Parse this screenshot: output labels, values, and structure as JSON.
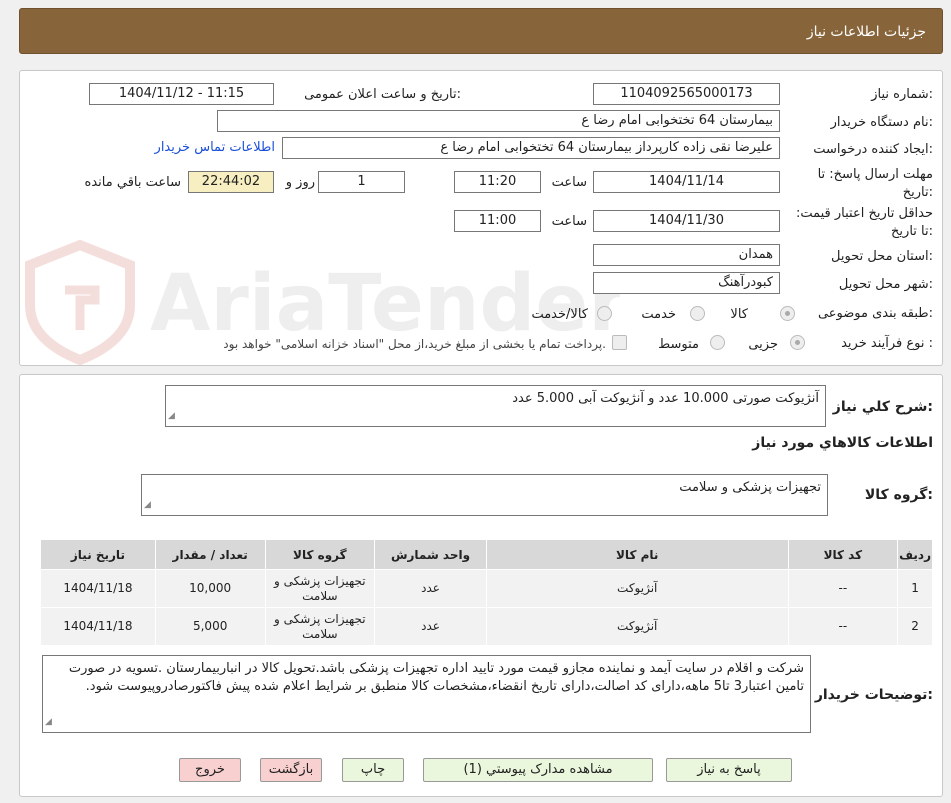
{
  "header": {
    "title": "جزئیات اطلاعات نیاز"
  },
  "form": {
    "need_number_label": "شماره نیاز:",
    "need_number": "1104092565000173",
    "announce_label": "تاریخ و ساعت اعلان عمومی:",
    "announce_value": "1404/11/12 - 11:15",
    "buyer_org_label": "نام دستگاه خریدار:",
    "buyer_org": "بیمارستان  64 تختخوابی امام رضا   ع",
    "creator_label": "ایجاد کننده درخواست:",
    "creator": "علیرضا نقی زاده کارپرداز بیمارستان  64 تختخوابی امام رضا   ع",
    "contact_link": "اطلاعات تماس خریدار",
    "deadline_label": "مهلت ارسال پاسخ: تا تاریخ:",
    "deadline_date": "1404/11/14",
    "time_label": "ساعت",
    "deadline_time": "11:20",
    "days_value": "1",
    "days_label": "روز و",
    "remaining_time": "22:44:02",
    "remaining_label": "ساعت باقي مانده",
    "validity_label": "حداقل تاریخ اعتبار قیمت: تا تاریخ:",
    "validity_date": "1404/11/30",
    "validity_time": "11:00",
    "province_label": "استان محل تحویل:",
    "province": "همدان",
    "city_label": "شهر محل تحویل:",
    "city": "کبودرآهنگ",
    "category_label": "طبقه بندی موضوعی:",
    "category_options": [
      "کالا",
      "خدمت",
      "کالا/خدمت"
    ],
    "process_label": "نوع فرآیند خرید :",
    "process_options": [
      "جزیی",
      "متوسط"
    ],
    "payment_note": "پرداخت تمام یا بخشی از مبلغ خرید،از محل \"اسناد خزانه اسلامی\" خواهد بود."
  },
  "summary": {
    "label": "شرح کلي نياز:",
    "text": "آنژیوکت صورتی 10.000 عدد و آنژیوکت آبی 5.000 عدد"
  },
  "goods": {
    "section_title": "اطلاعات کالاهاي مورد نياز",
    "group_label": "گروه کالا:",
    "group_value": "تجهیزات پزشکی و سلامت",
    "columns": [
      "ردیف",
      "کد کالا",
      "نام کالا",
      "واحد شمارش",
      "گروه کالا",
      "تعداد / مقدار",
      "تاریخ نیاز"
    ],
    "rows": [
      {
        "idx": "1",
        "code": "--",
        "name": "آنژیوکت",
        "unit": "عدد",
        "group": "تجهیزات پزشکی و سلامت",
        "qty": "10,000",
        "date": "1404/11/18"
      },
      {
        "idx": "2",
        "code": "--",
        "name": "آنژیوکت",
        "unit": "عدد",
        "group": "تجهیزات پزشکی و سلامت",
        "qty": "5,000",
        "date": "1404/11/18"
      }
    ]
  },
  "buyer_notes": {
    "label": "توضیحات خریدار:",
    "text": "شرکت و اقلام در سایت آیمد و نماینده مجازو قیمت مورد تایید اداره تجهیزات پزشکی باشد.تحویل کالا در انباربیمارستان .تسویه در صورت تامین اعتبار3 تا5 ماهه،دارای کد اصالت،دارای تاریخ انقضاء،مشخصات کالا منطبق بر شرایط اعلام شده پیش فاکتورصادروپیوست شود."
  },
  "buttons": {
    "reply": "پاسخ به نیاز",
    "view_docs": "مشاهده مدارک پیوستي (1)",
    "print": "چاپ",
    "back": "بازگشت",
    "exit": "خروج"
  },
  "watermark": {
    "text": "AriaTender.neT"
  }
}
